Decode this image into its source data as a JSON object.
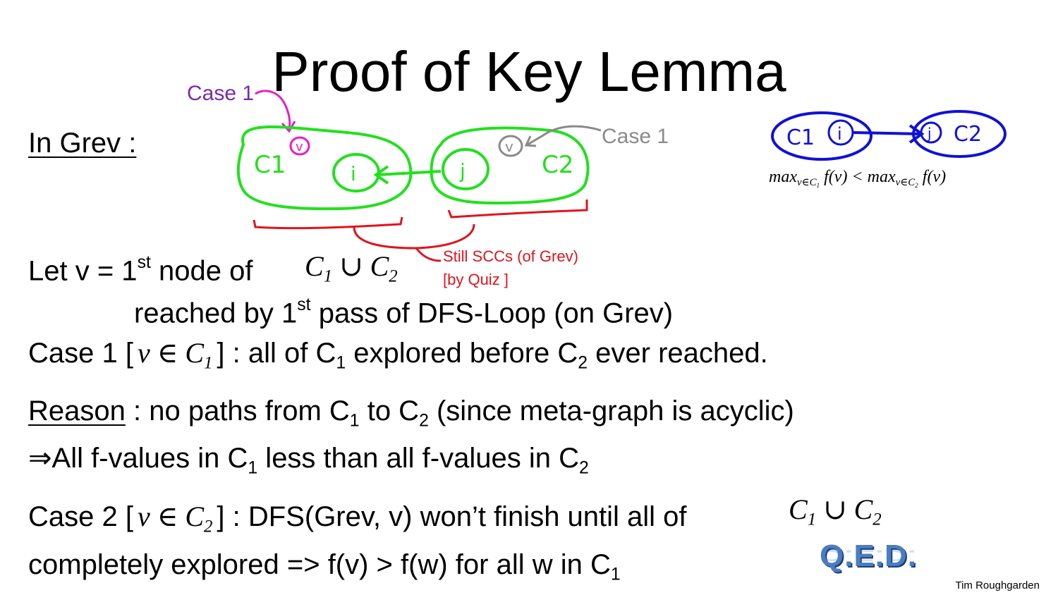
{
  "title": "Proof of Key Lemma",
  "in_grev": "In Grev :",
  "annotations": {
    "case1_magenta": "Case 1",
    "case1_gray": "Case 1",
    "still_sccs_line1": "Still SCCs (of Grev)",
    "still_sccs_line2": "[by Quiz ]",
    "c1_label": "C1",
    "c2_label": "C2",
    "node_i": "i",
    "node_j": "j",
    "node_v": "v"
  },
  "side_diagram": {
    "c1": "C1",
    "c2": "C2",
    "i": "i",
    "j": "j",
    "formula": "maxv∈C1 f(v) < maxv∈C2 f(v)"
  },
  "lines": {
    "let_v": "Let v = 1st node of",
    "union1": "C1 ∪ C2",
    "reached": "reached by 1st pass of DFS-Loop (on Grev)",
    "case1_prefix": "Case 1 [",
    "case1_math": "v ∈ C1",
    "case1_suffix": "] : all of C1 explored before C2 ever reached.",
    "reason_word": "Reason",
    "reason_rest": ": no paths from C1 to C2 (since meta-graph is acyclic)",
    "implies": "⇒All f-values in C1 less than all f-values in C2",
    "case2_prefix": "Case 2 [",
    "case2_math": "v ∈ C2",
    "case2_suffix": "] : DFS(Grev, v) won’t finish until all of",
    "union2": "C1 ∪ C2",
    "completely": "completely explored => f(v) > f(w) for all w in C1"
  },
  "qed": "Q.E.D.",
  "author": "Tim Roughgarden",
  "colors": {
    "green": "#22e01e",
    "red": "#e0141e",
    "magenta": "#e61ec8",
    "purple": "#7a2aa8",
    "gray": "#8a8a8a",
    "blue": "#1010d8",
    "qed_blue": "#4a7ec0"
  }
}
